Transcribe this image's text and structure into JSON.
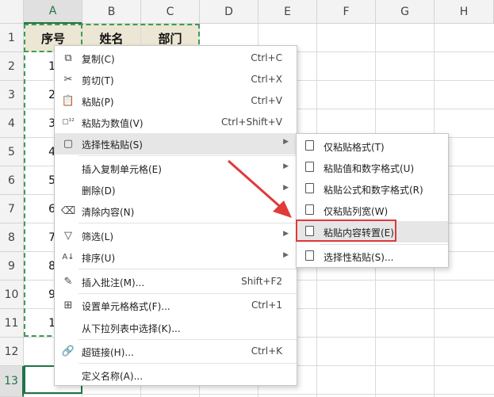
{
  "columns": [
    "A",
    "B",
    "C",
    "D",
    "E",
    "F",
    "G",
    "H"
  ],
  "rows": [
    "1",
    "2",
    "3",
    "4",
    "5",
    "6",
    "7",
    "8",
    "9",
    "10",
    "11",
    "12",
    "13"
  ],
  "header_cells": {
    "a": "序号",
    "b": "姓名",
    "c": "部门"
  },
  "row_numbers": [
    "1",
    "2",
    "3",
    "4",
    "5",
    "6",
    "7",
    "8",
    "9",
    "1"
  ],
  "menu": {
    "items": [
      {
        "label": "复制(C)",
        "shortcut": "Ctrl+C",
        "icon": "copy-icon"
      },
      {
        "label": "剪切(T)",
        "shortcut": "Ctrl+X",
        "icon": "scissors-icon"
      },
      {
        "label": "粘贴(P)",
        "shortcut": "Ctrl+V",
        "icon": "paste-icon"
      },
      {
        "label": "粘贴为数值(V)",
        "shortcut": "Ctrl+Shift+V",
        "icon": "paste-values-icon"
      },
      {
        "label": "选择性粘贴(S)",
        "shortcut": "",
        "icon": "paste-special-icon"
      },
      {
        "label": "插入复制单元格(E)",
        "shortcut": "",
        "icon": ""
      },
      {
        "label": "删除(D)",
        "shortcut": "",
        "icon": ""
      },
      {
        "label": "清除内容(N)",
        "shortcut": "",
        "icon": "eraser-icon"
      },
      {
        "label": "筛选(L)",
        "shortcut": "",
        "icon": "filter-icon"
      },
      {
        "label": "排序(U)",
        "shortcut": "",
        "icon": "sort-icon"
      },
      {
        "label": "插入批注(M)...",
        "shortcut": "Shift+F2",
        "icon": "comment-icon"
      },
      {
        "label": "设置单元格格式(F)...",
        "shortcut": "Ctrl+1",
        "icon": "format-cells-icon"
      },
      {
        "label": "从下拉列表中选择(K)...",
        "shortcut": "",
        "icon": ""
      },
      {
        "label": "超链接(H)...",
        "shortcut": "Ctrl+K",
        "icon": "link-icon"
      },
      {
        "label": "定义名称(A)...",
        "shortcut": "",
        "icon": ""
      }
    ]
  },
  "submenu": {
    "items": [
      {
        "label": "仅粘贴格式(T)"
      },
      {
        "label": "粘贴值和数字格式(U)"
      },
      {
        "label": "粘贴公式和数字格式(R)"
      },
      {
        "label": "仅粘贴列宽(W)"
      },
      {
        "label": "粘贴内容转置(E)"
      },
      {
        "label": "选择性粘贴(S)..."
      }
    ]
  },
  "colors": {
    "accent": "#217346",
    "highlight_box": "#e03a3a",
    "arrow": "#e03a3a",
    "header_fill": "#ece6d4"
  }
}
